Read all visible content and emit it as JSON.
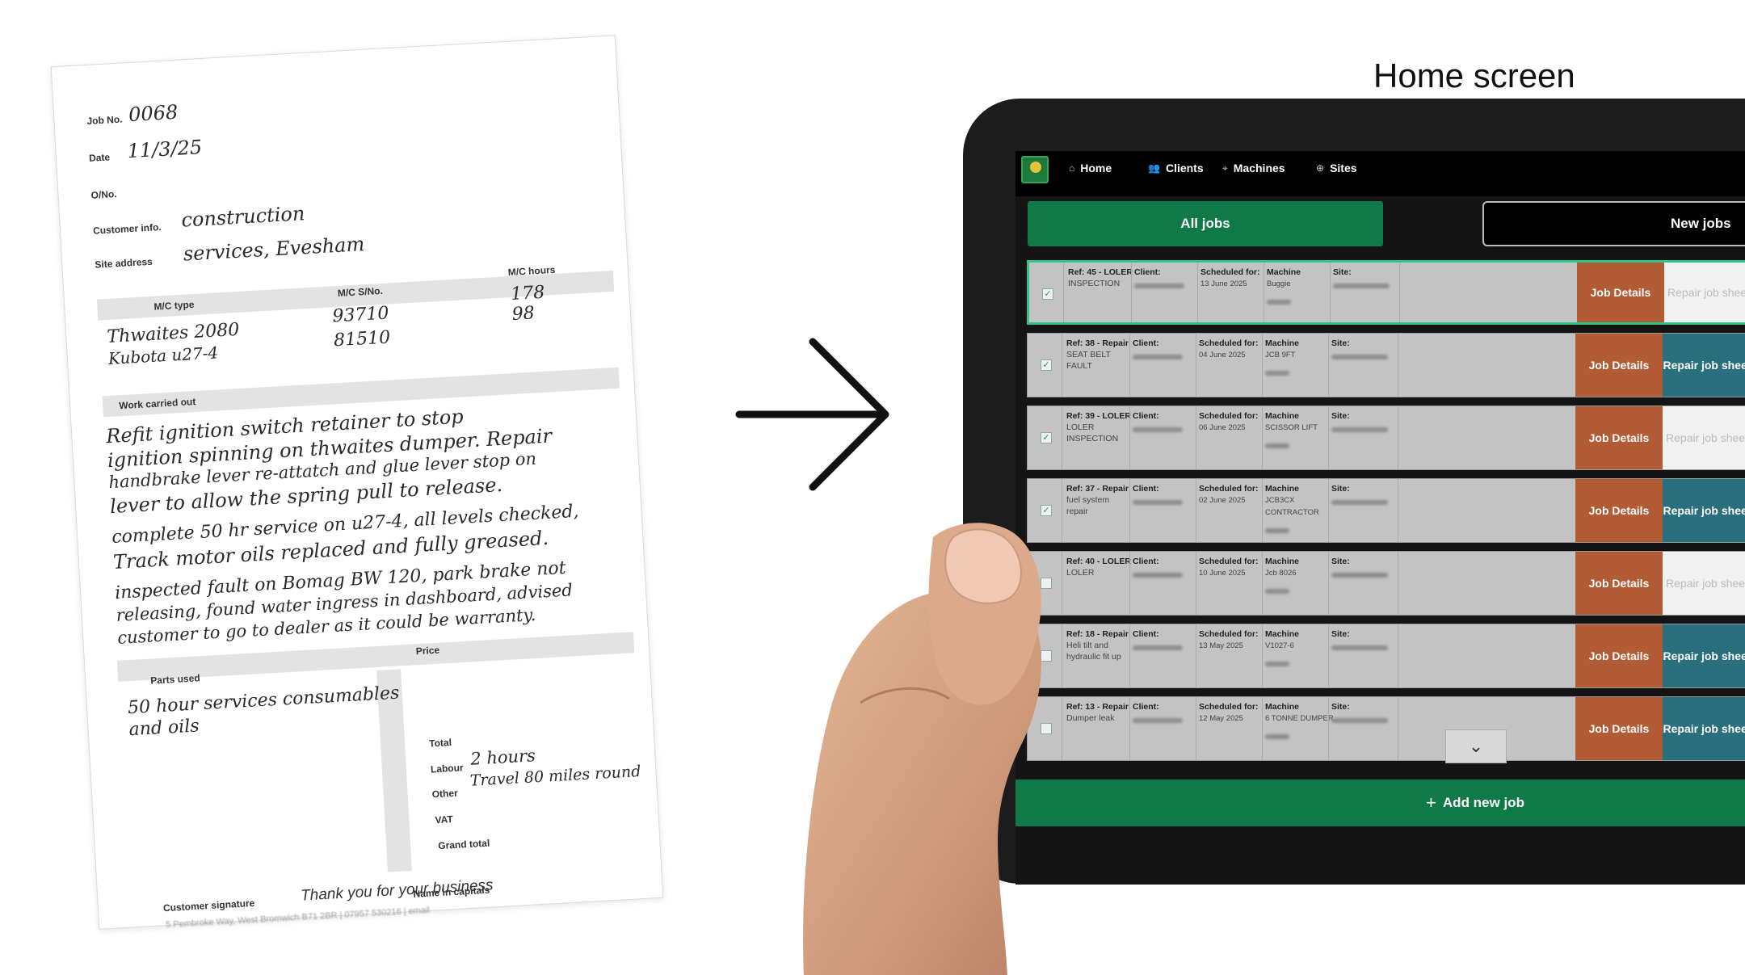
{
  "caption": "Home screen",
  "paper": {
    "job_no_label": "Job No.",
    "job_no_value": "0068",
    "date_label": "Date",
    "date_value": "11/3/25",
    "ono_label": "O/No.",
    "customer_label": "Customer info.",
    "customer_value": "construction",
    "site_label": "Site address",
    "site_value": "services, Evesham",
    "mc_type_label": "M/C type",
    "mc_sno_label": "M/C S/No.",
    "mc_hours_label": "M/C hours",
    "machines": [
      {
        "type": "Thwaites 2080",
        "sno": "93710",
        "hours": "178"
      },
      {
        "type": "Kubota u27-4",
        "sno": "81510",
        "hours": "98"
      }
    ],
    "work_label": "Work carried out",
    "work_lines": [
      "Refit ignition switch retainer to stop",
      "ignition spinning on thwaites dumper. Repair",
      "handbrake lever re-attatch and glue lever stop on",
      "lever to allow the spring pull to release.",
      "complete 50 hr service on u27-4, all levels checked,",
      "Track motor oils replaced and fully greased.",
      "inspected fault on Bomag BW 120, park brake not",
      "releasing, found water ingress in dashboard, advised",
      "customer to go to dealer as it could be warranty."
    ],
    "parts_label": "Parts used",
    "price_label": "Price",
    "parts_lines": [
      "50 hour services consumables",
      "and oils"
    ],
    "total_label": "Total",
    "labour_label": "Labour",
    "labour_value": "2 hours",
    "other_label": "Other",
    "other_value": "Travel 80 miles round",
    "vat_label": "VAT",
    "grand_total_label": "Grand total",
    "name_label": "Name in capitals",
    "signature_label": "Customer signature",
    "thanks": "Thank you for your business"
  },
  "app": {
    "nav": [
      {
        "label": "Home",
        "icon": "home-icon",
        "glyph": "⌂"
      },
      {
        "label": "Clients",
        "icon": "users-icon",
        "glyph": "👥"
      },
      {
        "label": "Machines",
        "icon": "machine-icon",
        "glyph": "⌖"
      },
      {
        "label": "Sites",
        "icon": "globe-icon",
        "glyph": "⊕"
      }
    ],
    "tabs": {
      "all": "All jobs",
      "new": "New jobs"
    },
    "labels": {
      "client": "Client:",
      "scheduled": "Scheduled for:",
      "machine": "Machine",
      "site": "Site:",
      "job_details": "Job Details",
      "repair_sheet": "Repair job sheet"
    },
    "jobs": [
      {
        "ref": "Ref: 45 - LOLER",
        "desc": "INSPECTION",
        "date": "13 June 2025",
        "machine": "Buggie",
        "checked": true,
        "repair_enabled": false
      },
      {
        "ref": "Ref: 38 - Repair",
        "desc": "SEAT BELT FAULT",
        "date": "04 June 2025",
        "machine": "JCB 9FT",
        "checked": true,
        "repair_enabled": true
      },
      {
        "ref": "Ref: 39 - LOLER",
        "desc": "LOLER INSPECTION",
        "date": "06 June 2025",
        "machine": "SCISSOR LIFT",
        "checked": true,
        "repair_enabled": false
      },
      {
        "ref": "Ref: 37 - Repair",
        "desc": "fuel system repair",
        "date": "02 June 2025",
        "machine": "JCB3CX CONTRACTOR",
        "checked": true,
        "repair_enabled": true
      },
      {
        "ref": "Ref: 40 - LOLER",
        "desc": "LOLER",
        "date": "10 June 2025",
        "machine": "Jcb 8026",
        "checked": false,
        "repair_enabled": false
      },
      {
        "ref": "Ref: 18 - Repair",
        "desc": "Heli tilt and hydraulic fit up",
        "date": "13 May 2025",
        "machine": "V1027-6",
        "checked": false,
        "repair_enabled": true
      },
      {
        "ref": "Ref: 13 - Repair",
        "desc": "Dumper leak",
        "date": "12 May 2025",
        "machine": "6 TONNE DUMPER",
        "checked": false,
        "repair_enabled": true
      }
    ],
    "add_job": "Add new job"
  }
}
